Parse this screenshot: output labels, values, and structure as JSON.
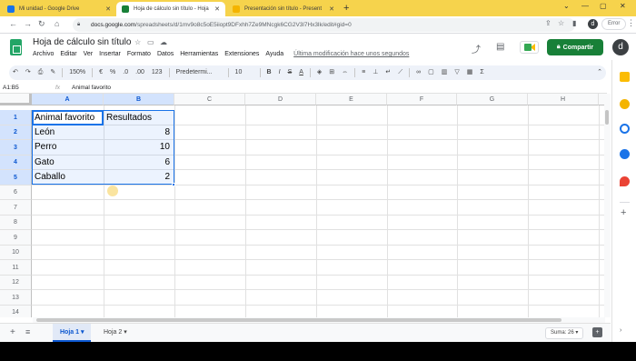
{
  "browser": {
    "tabs": [
      {
        "title": "Mi unidad - Google Drive",
        "active": false,
        "favicon_color": "#1a73e8"
      },
      {
        "title": "Hoja de cálculo sin título - Hoja",
        "active": true,
        "favicon_color": "#188038"
      },
      {
        "title": "Presentación sin título - Present",
        "active": false,
        "favicon_color": "#f4b400"
      }
    ],
    "new_tab_label": "+",
    "url_host": "docs.google.com",
    "url_path": "/spreadsheets/d/1mv9o8c5oE5iiopt9DFxhh7Ze9MNcgk6CG2V3l7Hx3lk/edit#gid=0",
    "profile_initial": "d",
    "error_label": "Error"
  },
  "app": {
    "title": "Hoja de cálculo sin título",
    "menu": [
      "Archivo",
      "Editar",
      "Ver",
      "Insertar",
      "Formato",
      "Datos",
      "Herramientas",
      "Extensiones",
      "Ayuda"
    ],
    "last_modified": "Última modificación hace unos segundos",
    "share_label": "Compartir",
    "avatar_initial": "d"
  },
  "toolbar": {
    "zoom": "150%",
    "currency": "€",
    "percent": "%",
    "decrease_decimals": ".0",
    "increase_decimals": ".00",
    "more_formats": "123",
    "font": "Predetermi...",
    "font_size": "10",
    "bold": "B",
    "italic": "I",
    "strike": "S",
    "text_color": "A"
  },
  "formula_bar": {
    "name_box": "A1:B5",
    "fx": "fx",
    "value": "Animal favorito"
  },
  "grid": {
    "columns": [
      "A",
      "B",
      "C",
      "D",
      "E",
      "F",
      "G",
      "H"
    ],
    "rows": [
      "1",
      "2",
      "3",
      "4",
      "5",
      "6",
      "7",
      "8",
      "9",
      "10",
      "11",
      "12",
      "13",
      "14"
    ],
    "cells": [
      {
        "a": "Animal favorito",
        "b": "Resultados"
      },
      {
        "a": "León",
        "b": "8"
      },
      {
        "a": "Perro",
        "b": "10"
      },
      {
        "a": "Gato",
        "b": "6"
      },
      {
        "a": "Caballo",
        "b": "2"
      }
    ]
  },
  "sheets": {
    "add": "+",
    "list": "≡",
    "tabs": [
      "Hoja 1",
      "Hoja 2"
    ],
    "sum": "Suma: 26"
  }
}
